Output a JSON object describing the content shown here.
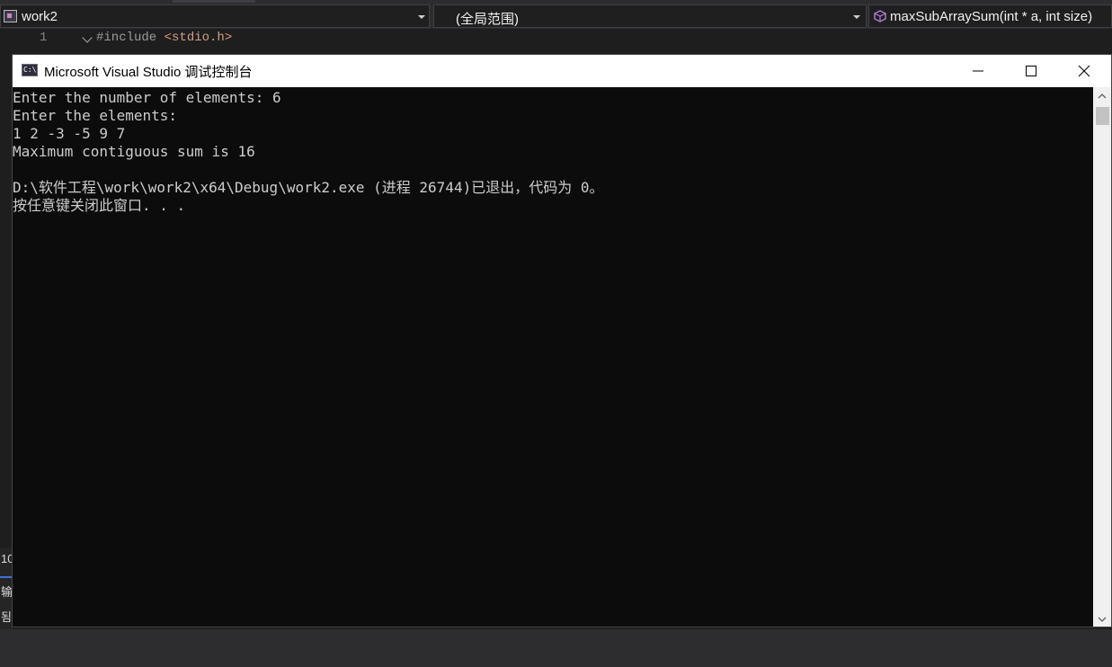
{
  "navbar": {
    "project": "work2",
    "scope": "(全局范围)",
    "member": "maxSubArraySum(int * a, int size)"
  },
  "editor": {
    "line_number": "1",
    "include_keyword": "#include ",
    "include_header": "<stdio.h>"
  },
  "left_panel": {
    "line_fragment": "10",
    "output_fragment": "输",
    "list_fragment": "됨"
  },
  "console": {
    "icon_glyph": "C:\\",
    "title": "Microsoft Visual Studio 调试控制台",
    "lines": [
      "Enter the number of elements: 6",
      "Enter the elements:",
      "1 2 -3 -5 9 7",
      "Maximum contiguous sum is 16",
      "",
      "D:\\软件工程\\work\\work2\\x64\\Debug\\work2.exe (进程 26744)已退出，代码为 0。",
      "按任意键关闭此窗口. . ."
    ]
  },
  "colors": {
    "console_bg": "#0c0c0c",
    "console_text": "#cccccc",
    "ide_bg": "#1e1e1e",
    "titlebar_bg": "#ffffff"
  }
}
